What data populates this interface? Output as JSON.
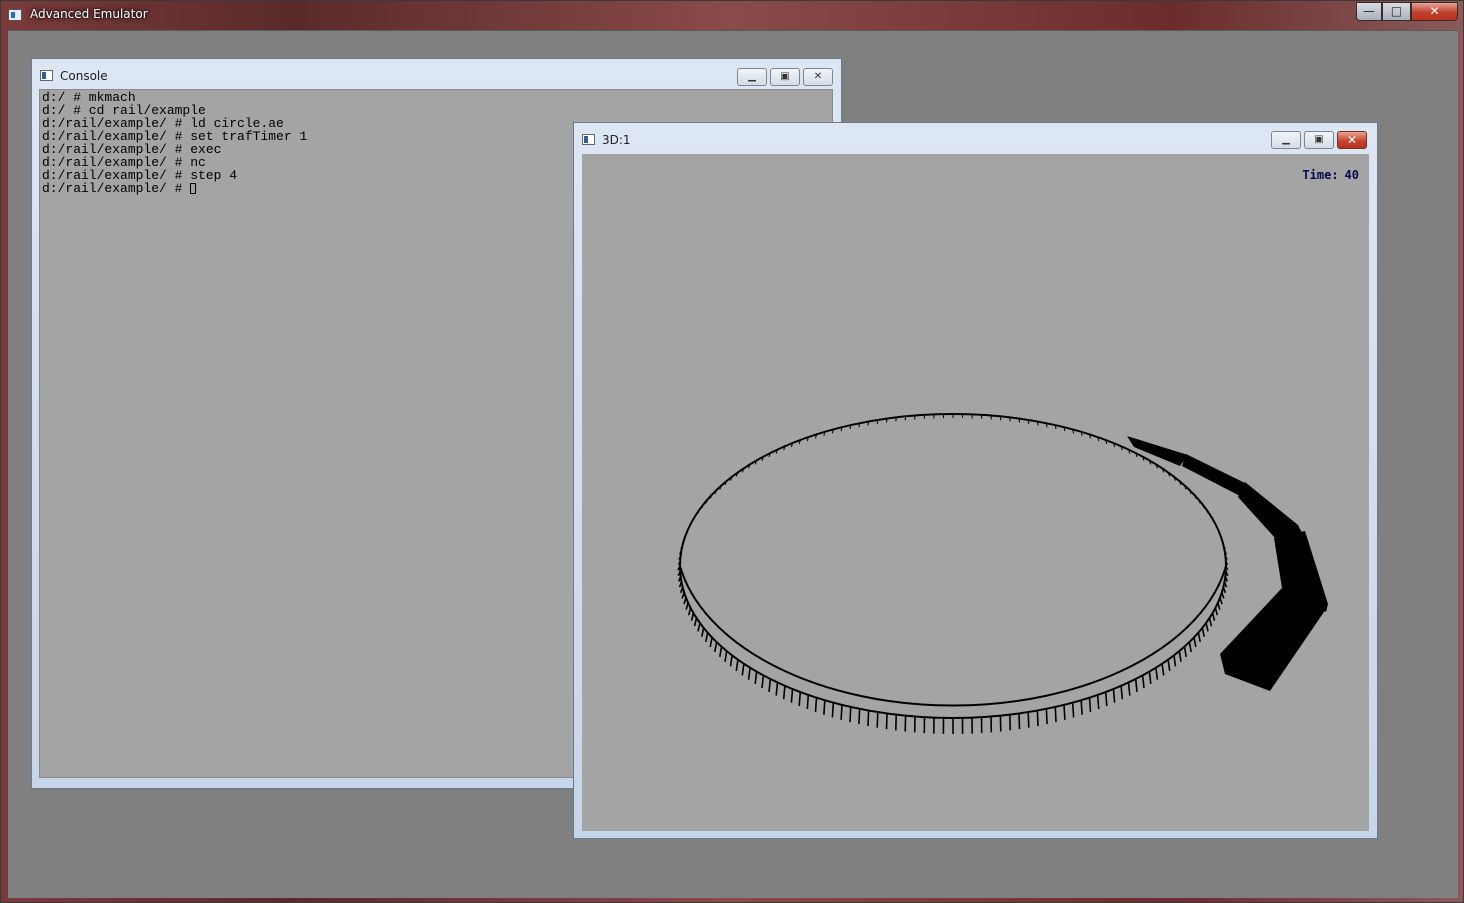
{
  "app": {
    "title": "Advanced Emulator",
    "controls": {
      "minimize": "—",
      "maximize": "□",
      "close": "✕"
    }
  },
  "console": {
    "title": "Console",
    "lines": [
      "d:/ # mkmach",
      "d:/ # cd rail/example",
      "d:/rail/example/ # ld circle.ae",
      "d:/rail/example/ # set trafTimer 1",
      "d:/rail/example/ # exec",
      "d:/rail/example/ # nc",
      "d:/rail/example/ # step 4",
      "d:/rail/example/ # "
    ],
    "controls": {
      "minimize": "▁",
      "maximize": "▣",
      "close": "✕"
    }
  },
  "view3d": {
    "title": "3D:1",
    "time_label": "Time:",
    "time_value": "40",
    "controls": {
      "minimize": "▁",
      "maximize": "▣",
      "close": "✕"
    },
    "track": {
      "shape": "ellipse",
      "sleeper_count": 180,
      "colors": {
        "track": "#000000",
        "background": "#a4a4a4"
      }
    }
  },
  "icons": {
    "app": "window-icon",
    "console": "window-icon",
    "view3d": "window-icon"
  }
}
